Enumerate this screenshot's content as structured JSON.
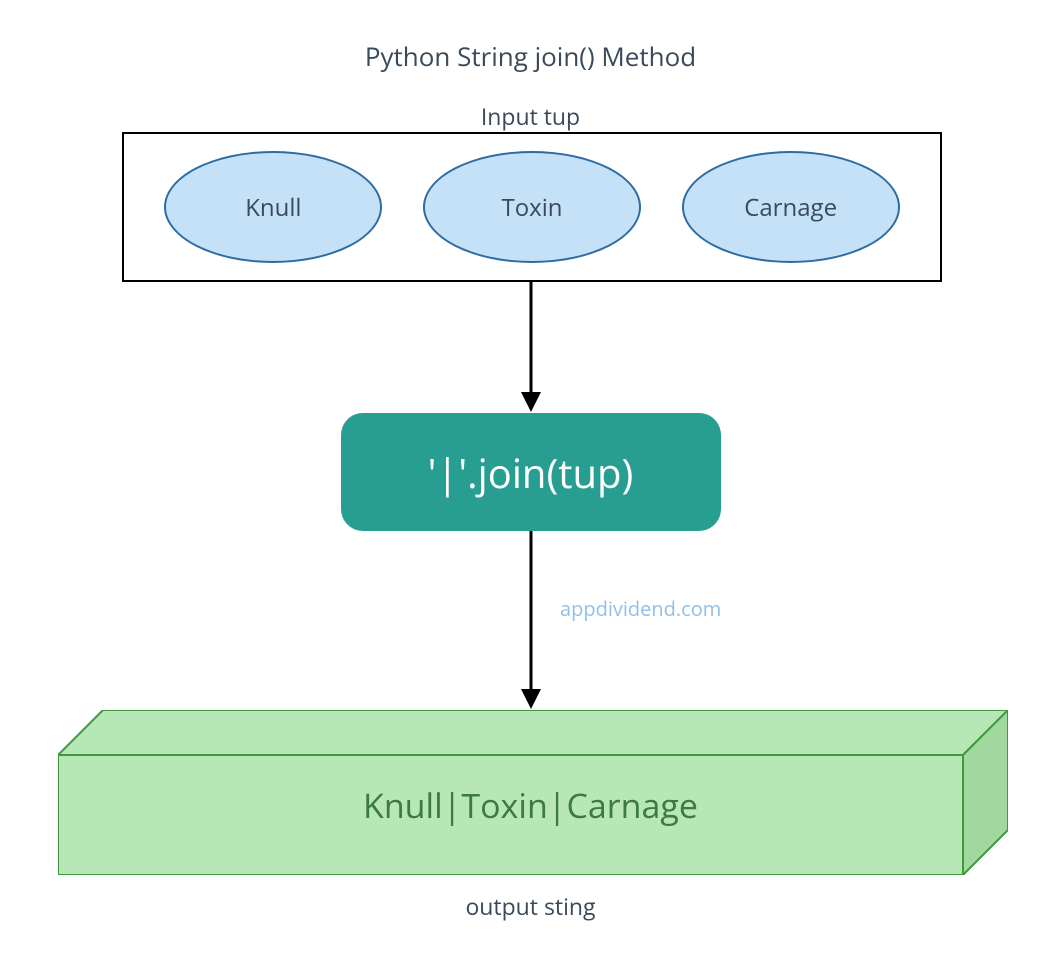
{
  "title": "Python String join() Method",
  "input_label": "Input tup",
  "input_items": [
    "Knull",
    "Toxin",
    "Carnage"
  ],
  "method_text": "'|'.join(tup)",
  "watermark": "appdividend.com",
  "output_text": "Knull|Toxin|Carnage",
  "output_label": "output sting",
  "colors": {
    "ellipse_fill": "#c4e1f7",
    "ellipse_stroke": "#2d6ca2",
    "method_fill": "#289e92",
    "output_fill": "#b7e6b7",
    "output_stroke": "#3d9a3d",
    "watermark_color": "#8fc0e8",
    "text_color": "#3a4a5a"
  }
}
